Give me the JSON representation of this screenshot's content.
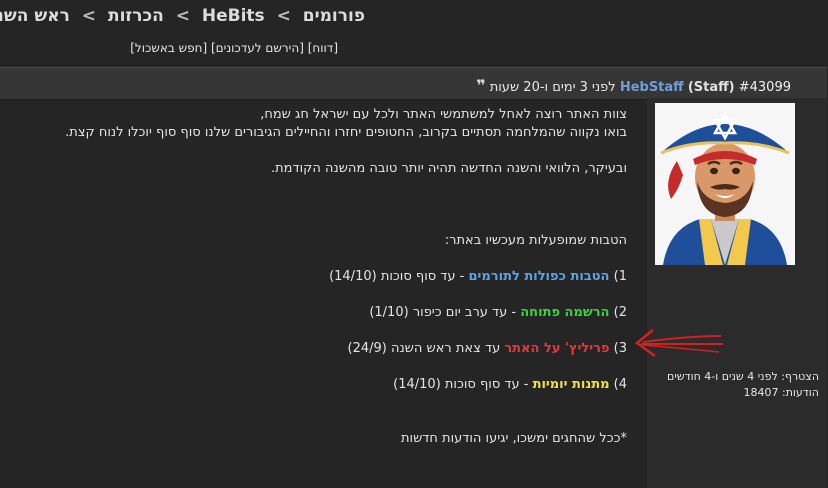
{
  "breadcrumb": {
    "items": [
      "פורומים",
      "HeBits",
      "הכרזות",
      "ראש השנה"
    ],
    "separator": ">"
  },
  "subnav": {
    "report": "[דווח]",
    "subscribe": "[הירשם לעדכונים]",
    "search": "[חפש באשכול]"
  },
  "post": {
    "number": "#43099",
    "username": "HebStaff",
    "role": "(Staff)",
    "time": "לפני 3 ימים ו-20 שעות",
    "quote_icon": "quote-icon"
  },
  "user": {
    "joined_label": "הצטרף:",
    "joined_value": "לפני 4 שנים ו-4 חודשים",
    "posts_label": "הודעות:",
    "posts_value": "18407"
  },
  "message": {
    "line1": "צוות האתר רוצה לאחל למשתמשי האתר ולכל עם ישראל חג שמח,",
    "line2": "בואו נקווה שהמלחמה תסתיים בקרוב, החטופים יחזרו והחיילים הגיבורים שלנו סוף סוף יוכלו לנוח קצת.",
    "line3": "ובעיקר, הלוואי והשנה החדשה תהיה יותר טובה מהשנה הקודמת.",
    "benefits_title": "הטבות שמופעלות מעכשיו באתר:",
    "items": [
      {
        "num": "1)",
        "highlight": "הטבות כפולות לתורמים",
        "rest": " - עד סוף סוכות (14/10)"
      },
      {
        "num": "2)",
        "highlight": "הרשמה פתוחה",
        "rest": " - עד ערב יום כיפור (1/10)"
      },
      {
        "num": "3)",
        "highlight": "פריליץ' על האתר",
        "rest": " עד צאת ראש השנה (24/9)"
      },
      {
        "num": "4)",
        "highlight": "מתנות יומיות",
        "rest": " - עד סוף סוכות (14/10)"
      }
    ],
    "footnote": "*ככל שהחגים ימשכו, יגיעו הודעות חדשות"
  },
  "colors": {
    "background": "#252525",
    "header_bar": "#363636",
    "username": "#6f9fd9",
    "blue_item": "#5ca3e6",
    "green_item": "#39d639",
    "red_item": "#e23a3a",
    "yellow_item": "#f0e33a",
    "annotation_arrow": "#d42020"
  }
}
